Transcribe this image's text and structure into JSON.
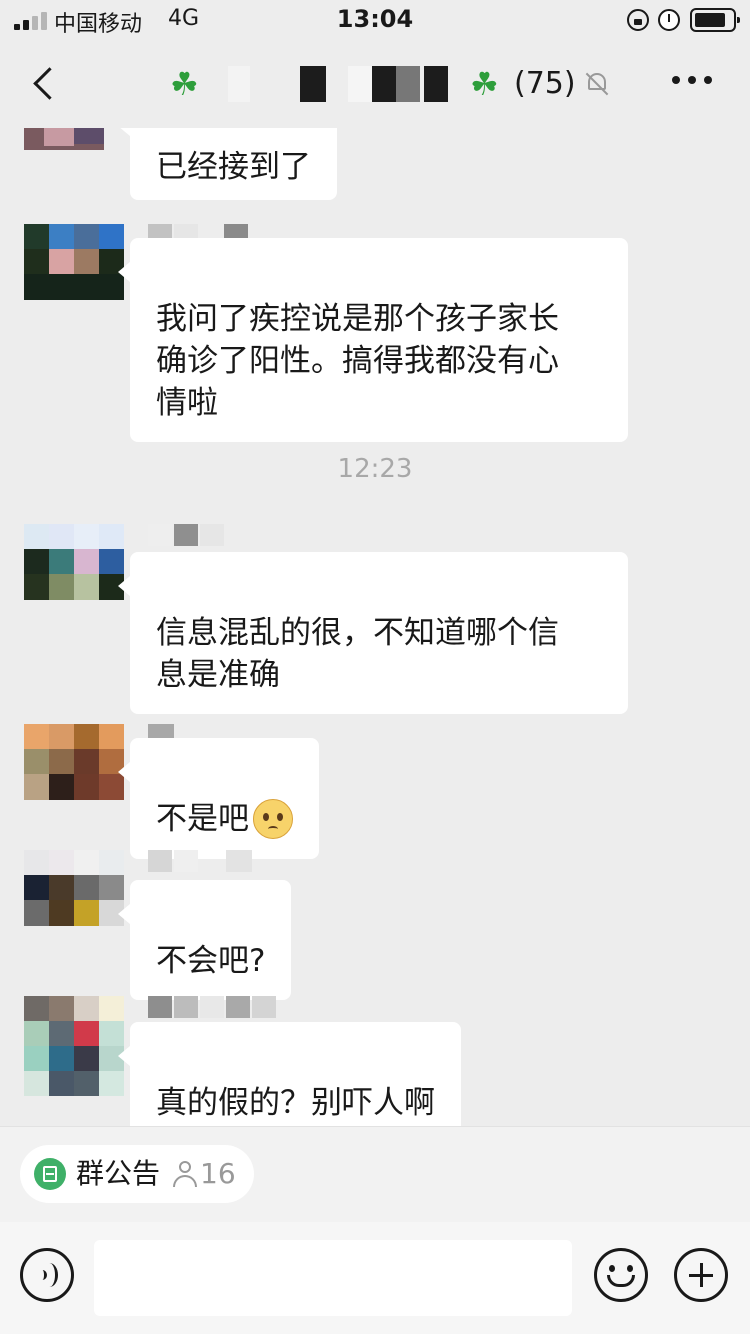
{
  "status_bar": {
    "carrier": "中国移动",
    "network": "4G",
    "time": "13:04"
  },
  "nav": {
    "title_suffix": "(75)",
    "title_icon": "four-leaf-clover",
    "mute_icon": "bell-off-icon",
    "more_icon": "ellipsis-icon"
  },
  "messages": [
    {
      "type": "text",
      "text": "已经接到了"
    },
    {
      "type": "text",
      "text": "我问了疾控说是那个孩子家长\n确诊了阳性。搞得我都没有心\n情啦"
    },
    {
      "type": "time",
      "text": "12:23"
    },
    {
      "type": "text",
      "text": "信息混乱的很，不知道哪个信\n息是准确"
    },
    {
      "type": "text",
      "text": "不是吧",
      "emoji": "pleading-face"
    },
    {
      "type": "text",
      "text": "不会吧?"
    },
    {
      "type": "text",
      "text": "真的假的？别吓人啊"
    }
  ],
  "announcement": {
    "label": "群公告",
    "count": "16",
    "accent": "#3fb068"
  },
  "input_bar": {
    "message_value": "",
    "voice_icon": "voice-icon",
    "emoji_icon": "smile-icon",
    "plus_icon": "plus-icon"
  },
  "colors": {
    "background": "#ededed",
    "bubble": "#ffffff",
    "time_text": "#a8a8a8",
    "clover": "#2e9e3b"
  }
}
